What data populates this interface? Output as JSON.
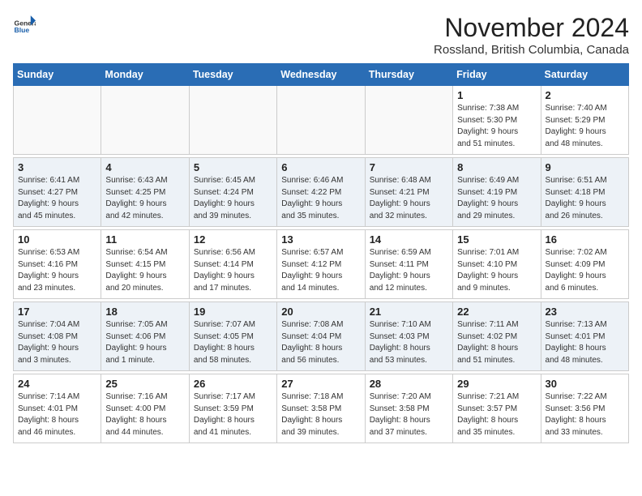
{
  "header": {
    "logo_general": "General",
    "logo_blue": "Blue",
    "month_title": "November 2024",
    "location": "Rossland, British Columbia, Canada"
  },
  "days_of_week": [
    "Sunday",
    "Monday",
    "Tuesday",
    "Wednesday",
    "Thursday",
    "Friday",
    "Saturday"
  ],
  "weeks": [
    {
      "alt": false,
      "days": [
        {
          "num": "",
          "info": ""
        },
        {
          "num": "",
          "info": ""
        },
        {
          "num": "",
          "info": ""
        },
        {
          "num": "",
          "info": ""
        },
        {
          "num": "",
          "info": ""
        },
        {
          "num": "1",
          "info": "Sunrise: 7:38 AM\nSunset: 5:30 PM\nDaylight: 9 hours\nand 51 minutes."
        },
        {
          "num": "2",
          "info": "Sunrise: 7:40 AM\nSunset: 5:29 PM\nDaylight: 9 hours\nand 48 minutes."
        }
      ]
    },
    {
      "alt": true,
      "days": [
        {
          "num": "3",
          "info": "Sunrise: 6:41 AM\nSunset: 4:27 PM\nDaylight: 9 hours\nand 45 minutes."
        },
        {
          "num": "4",
          "info": "Sunrise: 6:43 AM\nSunset: 4:25 PM\nDaylight: 9 hours\nand 42 minutes."
        },
        {
          "num": "5",
          "info": "Sunrise: 6:45 AM\nSunset: 4:24 PM\nDaylight: 9 hours\nand 39 minutes."
        },
        {
          "num": "6",
          "info": "Sunrise: 6:46 AM\nSunset: 4:22 PM\nDaylight: 9 hours\nand 35 minutes."
        },
        {
          "num": "7",
          "info": "Sunrise: 6:48 AM\nSunset: 4:21 PM\nDaylight: 9 hours\nand 32 minutes."
        },
        {
          "num": "8",
          "info": "Sunrise: 6:49 AM\nSunset: 4:19 PM\nDaylight: 9 hours\nand 29 minutes."
        },
        {
          "num": "9",
          "info": "Sunrise: 6:51 AM\nSunset: 4:18 PM\nDaylight: 9 hours\nand 26 minutes."
        }
      ]
    },
    {
      "alt": false,
      "days": [
        {
          "num": "10",
          "info": "Sunrise: 6:53 AM\nSunset: 4:16 PM\nDaylight: 9 hours\nand 23 minutes."
        },
        {
          "num": "11",
          "info": "Sunrise: 6:54 AM\nSunset: 4:15 PM\nDaylight: 9 hours\nand 20 minutes."
        },
        {
          "num": "12",
          "info": "Sunrise: 6:56 AM\nSunset: 4:14 PM\nDaylight: 9 hours\nand 17 minutes."
        },
        {
          "num": "13",
          "info": "Sunrise: 6:57 AM\nSunset: 4:12 PM\nDaylight: 9 hours\nand 14 minutes."
        },
        {
          "num": "14",
          "info": "Sunrise: 6:59 AM\nSunset: 4:11 PM\nDaylight: 9 hours\nand 12 minutes."
        },
        {
          "num": "15",
          "info": "Sunrise: 7:01 AM\nSunset: 4:10 PM\nDaylight: 9 hours\nand 9 minutes."
        },
        {
          "num": "16",
          "info": "Sunrise: 7:02 AM\nSunset: 4:09 PM\nDaylight: 9 hours\nand 6 minutes."
        }
      ]
    },
    {
      "alt": true,
      "days": [
        {
          "num": "17",
          "info": "Sunrise: 7:04 AM\nSunset: 4:08 PM\nDaylight: 9 hours\nand 3 minutes."
        },
        {
          "num": "18",
          "info": "Sunrise: 7:05 AM\nSunset: 4:06 PM\nDaylight: 9 hours\nand 1 minute."
        },
        {
          "num": "19",
          "info": "Sunrise: 7:07 AM\nSunset: 4:05 PM\nDaylight: 8 hours\nand 58 minutes."
        },
        {
          "num": "20",
          "info": "Sunrise: 7:08 AM\nSunset: 4:04 PM\nDaylight: 8 hours\nand 56 minutes."
        },
        {
          "num": "21",
          "info": "Sunrise: 7:10 AM\nSunset: 4:03 PM\nDaylight: 8 hours\nand 53 minutes."
        },
        {
          "num": "22",
          "info": "Sunrise: 7:11 AM\nSunset: 4:02 PM\nDaylight: 8 hours\nand 51 minutes."
        },
        {
          "num": "23",
          "info": "Sunrise: 7:13 AM\nSunset: 4:01 PM\nDaylight: 8 hours\nand 48 minutes."
        }
      ]
    },
    {
      "alt": false,
      "days": [
        {
          "num": "24",
          "info": "Sunrise: 7:14 AM\nSunset: 4:01 PM\nDaylight: 8 hours\nand 46 minutes."
        },
        {
          "num": "25",
          "info": "Sunrise: 7:16 AM\nSunset: 4:00 PM\nDaylight: 8 hours\nand 44 minutes."
        },
        {
          "num": "26",
          "info": "Sunrise: 7:17 AM\nSunset: 3:59 PM\nDaylight: 8 hours\nand 41 minutes."
        },
        {
          "num": "27",
          "info": "Sunrise: 7:18 AM\nSunset: 3:58 PM\nDaylight: 8 hours\nand 39 minutes."
        },
        {
          "num": "28",
          "info": "Sunrise: 7:20 AM\nSunset: 3:58 PM\nDaylight: 8 hours\nand 37 minutes."
        },
        {
          "num": "29",
          "info": "Sunrise: 7:21 AM\nSunset: 3:57 PM\nDaylight: 8 hours\nand 35 minutes."
        },
        {
          "num": "30",
          "info": "Sunrise: 7:22 AM\nSunset: 3:56 PM\nDaylight: 8 hours\nand 33 minutes."
        }
      ]
    }
  ]
}
